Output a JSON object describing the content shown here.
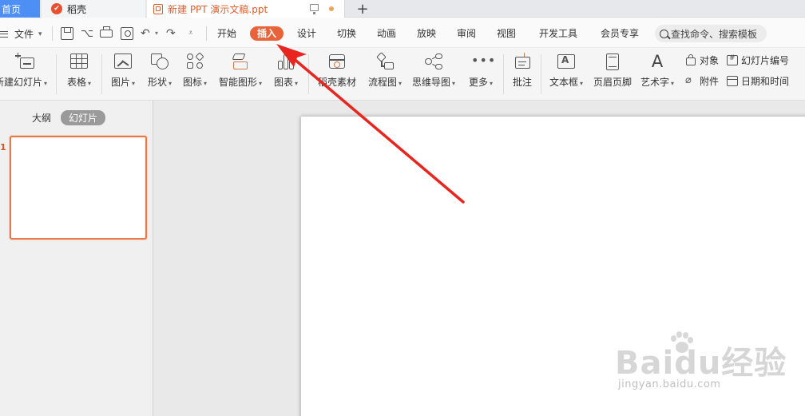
{
  "tabbar": {
    "home": "首页",
    "doke": "稻壳",
    "doc_title": "新建 PPT 演示文稿.ppt",
    "new_tab": "+"
  },
  "menu": {
    "file": "文件",
    "tabs": [
      "开始",
      "插入",
      "设计",
      "切换",
      "动画",
      "放映",
      "审阅",
      "视图",
      "开发工具",
      "会员专享"
    ],
    "active_tab": "插入",
    "search_placeholder": "查找命令、搜索模板"
  },
  "ribbon": {
    "new_slide": "新建幻灯片",
    "table": "表格",
    "picture": "图片",
    "shape": "形状",
    "icon": "图标",
    "smart_art": "智能图形",
    "chart": "图表",
    "doke_material": "稻壳素材",
    "flowchart": "流程图",
    "mindmap": "思维导图",
    "more": "更多",
    "comment": "批注",
    "textbox": "文本框",
    "header_footer": "页眉页脚",
    "wordart": "艺术字",
    "object": "对象",
    "attachment": "附件",
    "slide_number": "幻灯片编号",
    "date_time": "日期和时间"
  },
  "left_panel": {
    "tab_outline": "大纲",
    "tab_slides": "幻灯片",
    "slide_number": "1"
  },
  "watermark": {
    "main": "Baidu经验",
    "sub": "jingyan.baidu.com"
  },
  "colors": {
    "accent": "#e8633a",
    "home_tab": "#4d8ff5",
    "arrow": "#e8261f"
  }
}
